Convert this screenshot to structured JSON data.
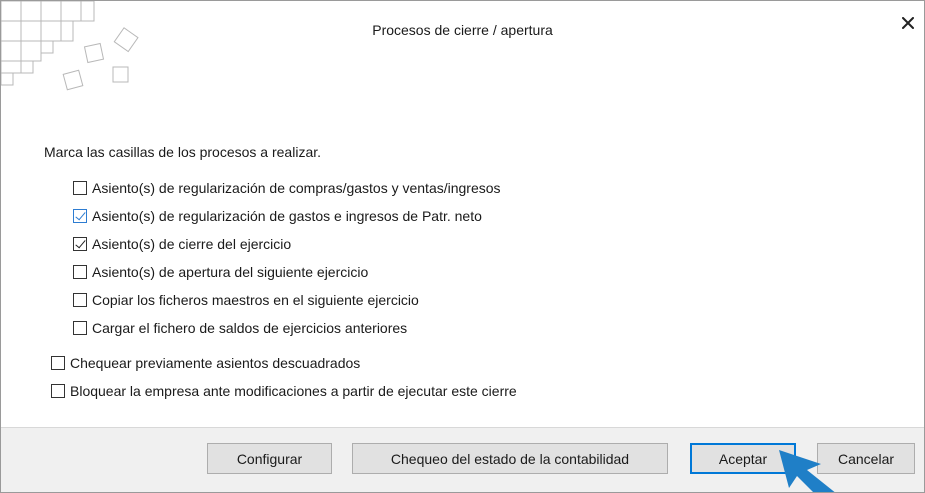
{
  "window": {
    "title": "Procesos de cierre / apertura",
    "close_icon": "close-icon"
  },
  "instruction": "Marca las casillas de los procesos a realizar.",
  "options": [
    {
      "label": "Asiento(s) de regularización de compras/gastos y ventas/ingresos",
      "checked": false
    },
    {
      "label": "Asiento(s) de regularización de gastos e ingresos de Patr. neto",
      "checked": true
    },
    {
      "label": "Asiento(s) de cierre del ejercicio",
      "checked": true
    },
    {
      "label": "Asiento(s) de apertura del siguiente ejercicio",
      "checked": false
    },
    {
      "label": "Copiar los ficheros maestros en el siguiente ejercicio",
      "checked": false
    },
    {
      "label": "Cargar el fichero de saldos de ejercicios anteriores",
      "checked": false
    }
  ],
  "extra_options": [
    {
      "label": "Chequear previamente asientos descuadrados",
      "checked": false
    },
    {
      "label": "Bloquear la empresa ante modificaciones a partir de ejecutar este cierre",
      "checked": false
    }
  ],
  "buttons": {
    "configurar": "Configurar",
    "chequeo": "Chequeo del estado de la contabilidad",
    "aceptar": "Aceptar",
    "cancelar": "Cancelar"
  },
  "colors": {
    "accent": "#0078d7",
    "cursor": "#1f7fc7",
    "footer_bg": "#f0f0f0"
  }
}
